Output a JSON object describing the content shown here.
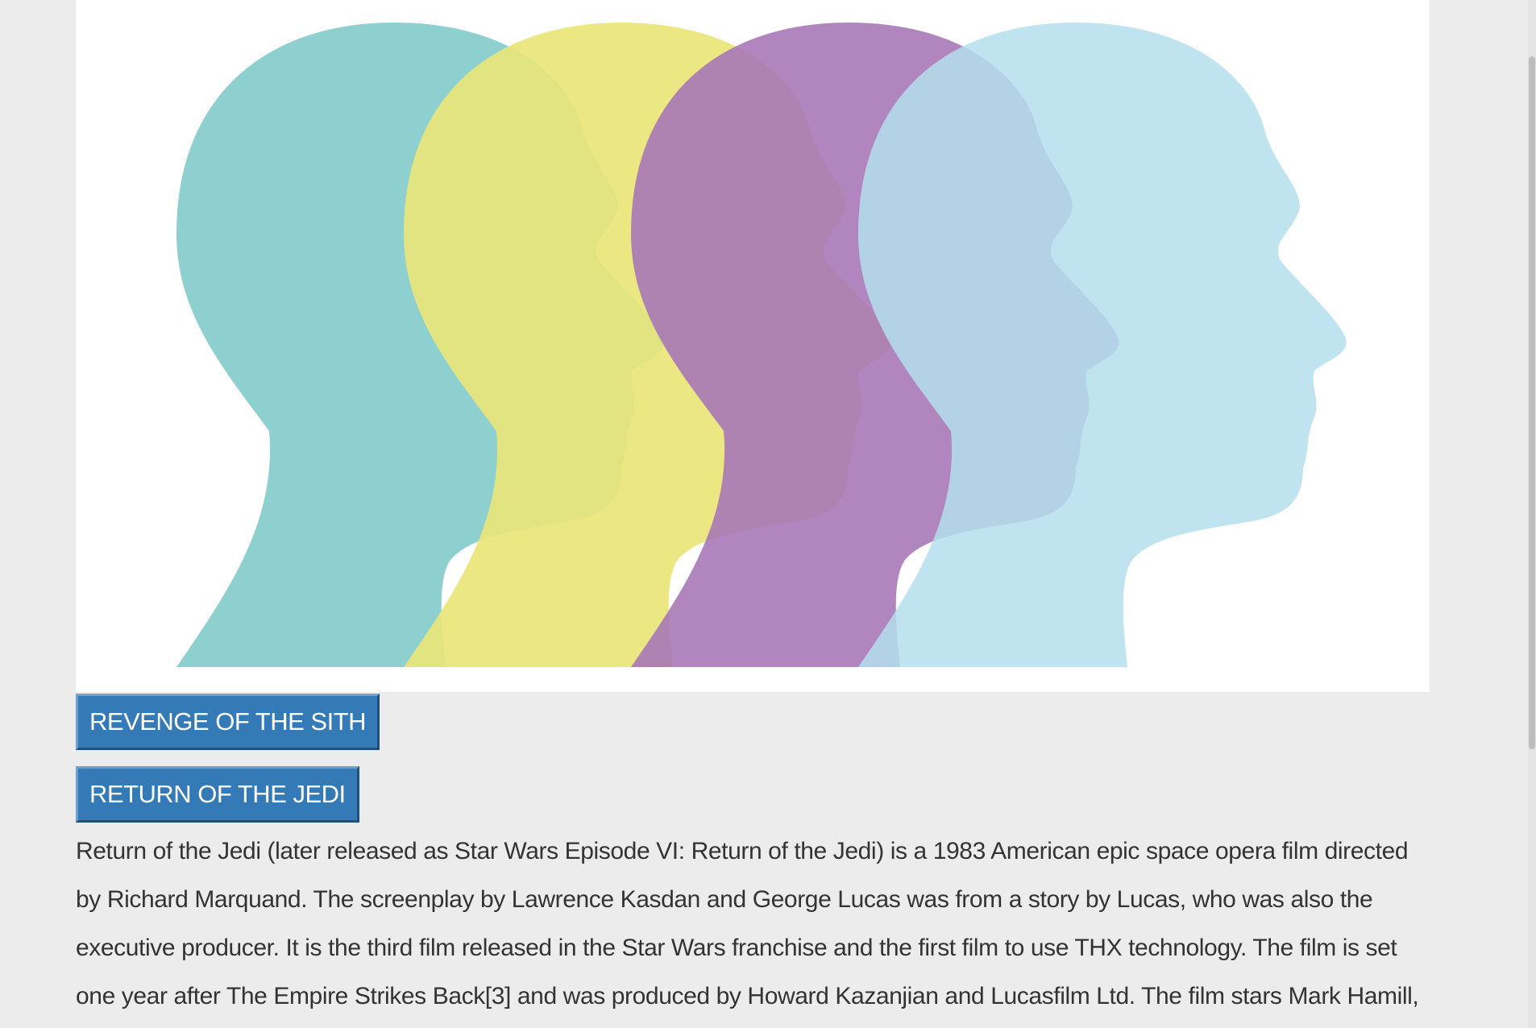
{
  "hero": {
    "image_icon": "four-colored-head-silhouettes-image",
    "colors": [
      "#8ecfd0",
      "#e9e67a",
      "#a978b6",
      "#b4dfec"
    ]
  },
  "accordion": {
    "items": [
      {
        "label": "REVENGE OF THE SITH"
      },
      {
        "label": "RETURN OF THE JEDI"
      }
    ]
  },
  "description": "Return of the Jedi (later released as Star Wars Episode VI: Return of the Jedi) is a 1983 American epic space opera film directed by Richard Marquand. The screenplay by Lawrence Kasdan and George Lucas was from a story by Lucas, who was also the executive producer. It is the third film released in the Star Wars franchise and the first film to use THX technology. The film is set one year after The Empire Strikes Back[3] and was produced by Howard Kazanjian and Lucasfilm Ltd. The film stars Mark Hamill, Harrison Ford, Carrie Fisher, Billy Dee Williams, Anthony Daniels, David Prowse, Kenny Baker, Peter Mayhew and",
  "accent_color": "#337ab7"
}
